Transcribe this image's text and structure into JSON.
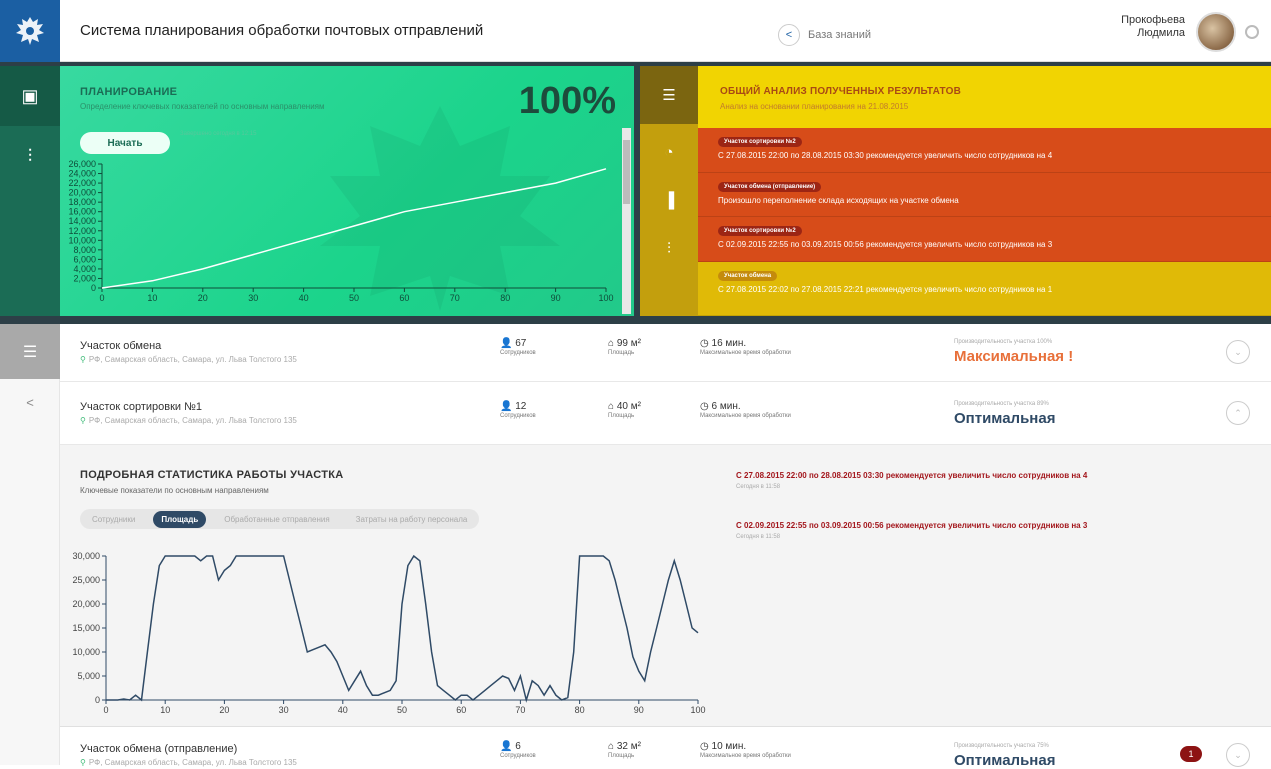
{
  "header": {
    "title": "Система планирования обработки почтовых отправлений",
    "knowledge_base": "База знаний",
    "user_line1": "Прокофьева",
    "user_line2": "Людмила"
  },
  "planning": {
    "title": "ПЛАНИРОВАНИЕ",
    "subtitle": "Определение ключевых показателей по основным направлениям",
    "percent": "100%",
    "start_label": "Начать",
    "hint": "Завершено сегодня в 12:15"
  },
  "analysis": {
    "title": "ОБЩИЙ АНАЛИЗ ПОЛУЧЕННЫХ РЕЗУЛЬТАТОВ",
    "subtitle": "Анализ на основании планирования на 21.08.2015",
    "items": [
      {
        "tag": "Участок сортировки №2",
        "text": "С 27.08.2015 22:00 по 28.08.2015 03:30 рекомендуется увеличить число сотрудников на 4",
        "bg": "#d74c19",
        "tagbg": "#9c2514"
      },
      {
        "tag": "Участок обмена (отправление)",
        "text": "Произошло переполнение склада исходящих на участке обмена",
        "bg": "#d74c19",
        "tagbg": "#9c2514"
      },
      {
        "tag": "Участок сортировки №2",
        "text": "С 02.09.2015 22:55 по 03.09.2015 00:56 рекомендуется увеличить число сотрудников на 3",
        "bg": "#d74c19",
        "tagbg": "#9c2514"
      },
      {
        "tag": "Участок обмена",
        "text": "С 27.08.2015 22:02 по 27.08.2015 22:21 рекомендуется увеличить число сотрудников на 1",
        "bg": "#e0ba07",
        "tagbg": "#c48b0c"
      }
    ]
  },
  "rows": [
    {
      "name": "Участок обмена",
      "address": "РФ, Самарская область, Самара, ул. Льва Толстого 135",
      "staff": "67",
      "staff_label": "Сотрудников",
      "area": "99 м²",
      "area_label": "Площадь",
      "time": "16 мин.",
      "time_label": "Максимальное время обработки",
      "prod_label": "Производительность участка 100%",
      "prod": "Максимальная !",
      "prod_color": "#e8703a",
      "chevron": "⌄",
      "badge": ""
    },
    {
      "name": "Участок сортировки №1",
      "address": "РФ, Самарская область, Самара, ул. Льва Толстого 135",
      "staff": "12",
      "staff_label": "Сотрудников",
      "area": "40 м²",
      "area_label": "Площадь",
      "time": "6 мин.",
      "time_label": "Максимальное время обработки",
      "prod_label": "Производительность участка 89%",
      "prod": "Оптимальная",
      "prod_color": "#2f4a66",
      "chevron": "⌃",
      "badge": ""
    },
    {
      "name": "Участок обмена (отправление)",
      "address": "РФ, Самарская область, Самара, ул. Льва Толстого 135",
      "staff": "6",
      "staff_label": "Сотрудников",
      "area": "32 м²",
      "area_label": "Площадь",
      "time": "10 мин.",
      "time_label": "Максимальное время обработки",
      "prod_label": "Производительность участка 75%",
      "prod": "Оптимальная",
      "prod_color": "#2f4a66",
      "chevron": "⌄",
      "badge": "1"
    }
  ],
  "detail": {
    "title": "ПОДРОБНАЯ СТАТИСТИКА РАБОТЫ УЧАСТКА",
    "subtitle": "Ключевые показатели по основным направлениям",
    "tabs": [
      "Сотрудники",
      "Площадь",
      "Обработанные отправления",
      "Затраты на работу персонала"
    ],
    "recommendations": [
      {
        "text": "С 27.08.2015 22:00 по 28.08.2015 03:30 рекомендуется увеличить число сотрудников на 4",
        "time": "Сегодня в 11:58"
      },
      {
        "text": "С 02.09.2015 22:55 по 03.09.2015 00:56 рекомендуется увеличить число сотрудников на 3",
        "time": "Сегодня в 11:58"
      }
    ]
  },
  "icons": {
    "logo": "double-eagle-logo",
    "knowledge": "share-icon",
    "settings": "gear-icon"
  },
  "colors": {
    "green_panel": "#1bd48b",
    "yellow_panel": "#f1d402",
    "alert_red": "#d74c19",
    "accent_navy": "#2f4a66"
  },
  "chart_data": [
    {
      "type": "line",
      "title": "",
      "x": [
        0,
        10,
        20,
        30,
        40,
        50,
        60,
        70,
        80,
        90,
        100
      ],
      "values": [
        0,
        1500,
        4000,
        7000,
        10000,
        13000,
        16000,
        18000,
        20000,
        22000,
        25000
      ],
      "xlim": [
        0,
        100
      ],
      "ylim": [
        0,
        26000
      ],
      "yticks": [
        "0",
        "2,000",
        "4,000",
        "6,000",
        "8,000",
        "10,000",
        "12,000",
        "14,000",
        "16,000",
        "18,000",
        "20,000",
        "22,000",
        "24,000",
        "26,000"
      ],
      "xticks": [
        "0",
        "10",
        "20",
        "30",
        "40",
        "50",
        "60",
        "70",
        "80",
        "90",
        "100"
      ]
    },
    {
      "type": "line",
      "title": "",
      "x": [
        0,
        2,
        3,
        4,
        5,
        6,
        7,
        8,
        9,
        10,
        11,
        12,
        13,
        14,
        15,
        16,
        17,
        18,
        19,
        20,
        21,
        22,
        23,
        24,
        25,
        26,
        27,
        28,
        29,
        30,
        31,
        32,
        33,
        34,
        35,
        36,
        37,
        38,
        39,
        40,
        41,
        42,
        43,
        44,
        45,
        46,
        47,
        48,
        49,
        50,
        51,
        52,
        53,
        54,
        55,
        56,
        57,
        58,
        59,
        60,
        61,
        62,
        63,
        64,
        65,
        66,
        67,
        68,
        69,
        70,
        71,
        72,
        73,
        74,
        75,
        76,
        77,
        78,
        79,
        80,
        81,
        82,
        83,
        84,
        85,
        86,
        87,
        88,
        89,
        90,
        91,
        92,
        93,
        94,
        95,
        96,
        97,
        98,
        99,
        100
      ],
      "values": [
        0,
        0,
        200,
        0,
        1000,
        0,
        10000,
        20000,
        28000,
        30000,
        30000,
        30000,
        30000,
        30000,
        30000,
        29000,
        30000,
        30000,
        25000,
        27000,
        28000,
        30000,
        30000,
        30000,
        30000,
        30000,
        30000,
        30000,
        30000,
        30000,
        25000,
        20000,
        15000,
        10000,
        10500,
        11000,
        11500,
        10000,
        8000,
        5000,
        2000,
        4000,
        6000,
        3000,
        1000,
        1000,
        1500,
        2000,
        4000,
        20000,
        28000,
        30000,
        29000,
        20000,
        10000,
        3000,
        2000,
        1000,
        0,
        1000,
        1000,
        0,
        1000,
        2000,
        3000,
        4000,
        5000,
        4500,
        2000,
        5000,
        0,
        4000,
        3000,
        1000,
        3000,
        1000,
        0,
        500,
        10000,
        30000,
        30000,
        30000,
        30000,
        30000,
        29000,
        25000,
        20000,
        15000,
        9000,
        6000,
        4000,
        10000,
        15000,
        20000,
        25000,
        29000,
        25000,
        20000,
        15000,
        14000
      ],
      "xlim": [
        0,
        100
      ],
      "ylim": [
        0,
        30000
      ],
      "yticks": [
        "0",
        "5,000",
        "10,000",
        "15,000",
        "20,000",
        "25,000",
        "30,000"
      ],
      "xticks": [
        "0",
        "10",
        "20",
        "30",
        "40",
        "50",
        "60",
        "70",
        "80",
        "90",
        "100"
      ]
    }
  ]
}
